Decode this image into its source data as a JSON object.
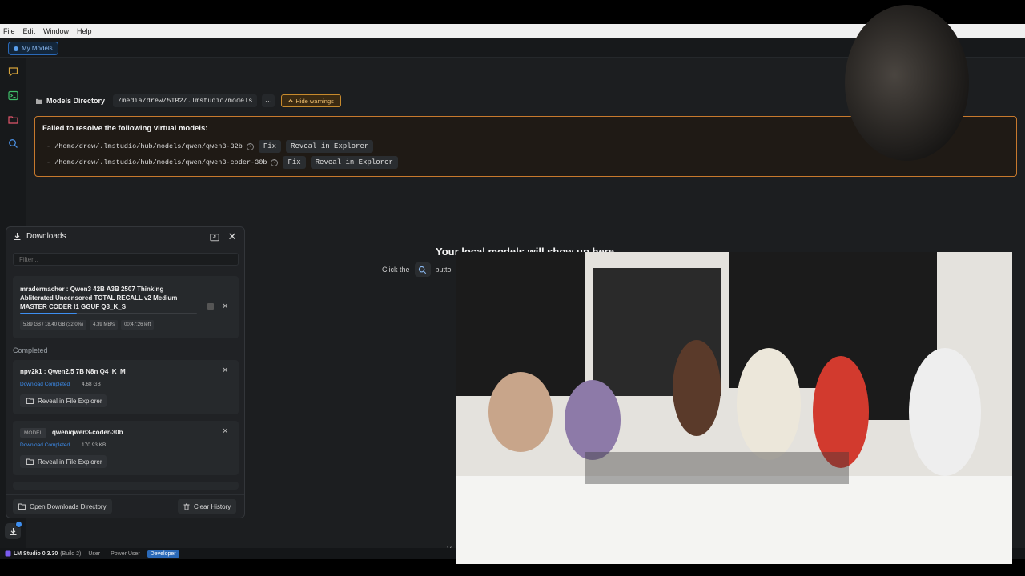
{
  "menubar": {
    "items": [
      "File",
      "Edit",
      "Window",
      "Help"
    ]
  },
  "topstrip": {
    "my_models": "My Models"
  },
  "directory": {
    "label": "Models Directory",
    "path": "/media/drew/5TB2/.lmstudio/models",
    "more": "···",
    "hide_warnings": "Hide warnings"
  },
  "warning": {
    "title": "Failed to resolve the following virtual models:",
    "items": [
      {
        "path": "- /home/drew/.lmstudio/hub/models/qwen/qwen3-32b",
        "fix": "Fix",
        "reveal": "Reveal in Explorer"
      },
      {
        "path": "- /home/drew/.lmstudio/hub/models/qwen/qwen3-coder-30b",
        "fix": "Fix",
        "reveal": "Reveal in Explorer"
      }
    ]
  },
  "empty_state": {
    "title": "Your local models will show up here.",
    "click_the": "Click the",
    "button_text": "butto",
    "you": "You"
  },
  "downloads": {
    "title": "Downloads",
    "filter_placeholder": "Filter...",
    "active": {
      "name": "mradermacher : Qwen3 42B A3B 2507 Thinking Abliterated Uncensored TOTAL RECALL v2 Medium MASTER CODER I1 GGUF Q3_K_S",
      "progress": 0.32,
      "size": "5.89 GB / 18.40 GB",
      "percent": "(32.0%)",
      "speed": "4.39 MB/s",
      "eta": "00:47:26 left"
    },
    "completed_label": "Completed",
    "completed": [
      {
        "name": "npv2k1 : Qwen2.5 7B N8n Q4_K_M",
        "status": "Download Completed",
        "size": "4.68 GB",
        "reveal": "Reveal in File Explorer"
      },
      {
        "badge": "MODEL",
        "name": "qwen/qwen3-coder-30b",
        "status": "Download Completed",
        "size": "170.93 KB",
        "reveal": "Reveal in File Explorer"
      }
    ],
    "open_dir": "Open Downloads Directory",
    "clear_history": "Clear History"
  },
  "statusbar": {
    "app": "LM Studio 0.3.30",
    "build": "(Build 2)",
    "modes": [
      "User",
      "Power User",
      "Developer"
    ],
    "active_mode": "Developer"
  },
  "colors": {
    "accent": "#3d8ef0",
    "warning": "#c7792d",
    "background": "#1c1e20"
  },
  "icons": [
    "chat-icon",
    "terminal-icon",
    "folder-icon",
    "search-icon",
    "download-icon",
    "popout-icon",
    "close-icon",
    "pause-icon"
  ]
}
